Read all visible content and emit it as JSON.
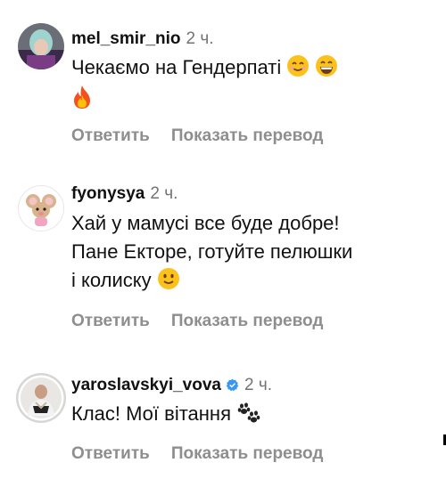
{
  "comments": [
    {
      "username": "mel_smir_nio",
      "time": "2 ч.",
      "text_lines": [
        "Чекаємо на Гендерпаті"
      ],
      "reply_label": "Ответить",
      "translate_label": "Показать перевод",
      "emojis": [
        "smiling-face-icon",
        "grinning-face-icon",
        "fire-icon"
      ]
    },
    {
      "username": "fyonysya",
      "time": "2 ч.",
      "text_lines": [
        "Хай у мамусі все буде добре!",
        "Пане Екторе, готуйте пелюшки",
        "і колиску"
      ],
      "reply_label": "Ответить",
      "translate_label": "Показать перевод",
      "emojis": [
        "slightly-smiling-face-icon"
      ]
    },
    {
      "username": "yaroslavskyi_vova",
      "time": "2 ч.",
      "verified": true,
      "text_lines": [
        "Клас! Мої вітання"
      ],
      "reply_label": "Ответить",
      "translate_label": "Показать перевод",
      "emojis": [
        "paw-prints-icon"
      ]
    }
  ],
  "colors": {
    "text": "#111111",
    "meta": "#737373",
    "action": "#8e8e8e",
    "verified": "#3897f0",
    "story_ring": "#d6d6d6"
  }
}
